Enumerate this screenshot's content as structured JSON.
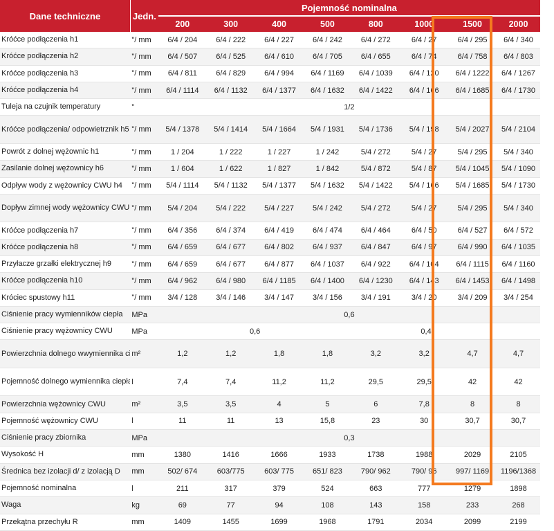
{
  "header": {
    "param_title": "Dane techniczne",
    "unit_title": "Jedn.",
    "capacity_title": "Pojemność nominalna",
    "capacities": [
      "200",
      "300",
      "400",
      "500",
      "800",
      "1000",
      "1500",
      "2000"
    ]
  },
  "highlight": {
    "column": "1500",
    "color": "#f47a1f"
  },
  "accent_color": "#c8202e",
  "rows": [
    {
      "name": "Króćce podłączenia h1",
      "unit": "\"/ mm",
      "values": [
        "6/4 / 204",
        "6/4 / 222",
        "6/4 / 227",
        "6/4 / 242",
        "6/4 / 272",
        "6/4 / 27",
        "6/4 / 295",
        "6/4 / 340"
      ]
    },
    {
      "name": "Króćce podłączenia h2",
      "unit": "\"/ mm",
      "values": [
        "6/4 / 507",
        "6/4 / 525",
        "6/4 / 610",
        "6/4 / 705",
        "6/4 / 655",
        "6/4 / 74",
        "6/4 / 758",
        "6/4 / 803"
      ]
    },
    {
      "name": "Króćce podłączenia h3",
      "unit": "\"/ mm",
      "values": [
        "6/4 / 811",
        "6/4 / 829",
        "6/4 / 994",
        "6/4 / 1169",
        "6/4 / 1039",
        "6/4 / 120",
        "6/4 / 1222",
        "6/4 / 1267"
      ]
    },
    {
      "name": "Króćce podłączenia h4",
      "unit": "\"/ mm",
      "values": [
        "6/4 / 1114",
        "6/4 / 1132",
        "6/4 / 1377",
        "6/4 / 1632",
        "6/4 / 1422",
        "6/4 / 166",
        "6/4 / 1685",
        "6/4 / 1730"
      ]
    },
    {
      "name": "Tuleja na czujnik temperatury",
      "unit": "\"",
      "span": "1/2"
    },
    {
      "name": "Króćce podłączenia/ odpowietrznik h5",
      "unit": "\"/ mm",
      "tall": true,
      "values": [
        "5/4 / 1378",
        "5/4 / 1414",
        "5/4 / 1664",
        "5/4 / 1931",
        "5/4 / 1736",
        "5/4 / 198",
        "5/4 / 2027",
        "5/4 / 2104"
      ]
    },
    {
      "name": "Powrót z dolnej wężownic h1",
      "unit": "\"/ mm",
      "values": [
        "1 / 204",
        "1 / 222",
        "1 / 227",
        "1 / 242",
        "5/4 / 272",
        "5/4 / 27",
        "5/4 / 295",
        "5/4 / 340"
      ]
    },
    {
      "name": "Zasilanie dolnej wężownicy h6",
      "unit": "\"/ mm",
      "values": [
        "1 / 604",
        "1 / 622",
        "1 / 827",
        "1 / 842",
        "5/4 / 872",
        "5/4 / 87",
        "5/4 / 1045",
        "5/4 / 1090"
      ]
    },
    {
      "name": "Odpływ wody z wężownicy CWU h4",
      "unit": "\"/ mm",
      "values": [
        "5/4 / 1114",
        "5/4 / 1132",
        "5/4 / 1377",
        "5/4 / 1632",
        "5/4 / 1422",
        "5/4 / 166",
        "5/4 / 1685",
        "5/4 / 1730"
      ]
    },
    {
      "name": "Dopływ zimnej wody wężownicy CWU h1",
      "unit": "\"/ mm",
      "tall": true,
      "values": [
        "5/4 / 204",
        "5/4 / 222",
        "5/4 / 227",
        "5/4 / 242",
        "5/4 / 272",
        "5/4 / 27",
        "5/4 / 295",
        "5/4 / 340"
      ]
    },
    {
      "name": "Króćce podłączenia h7",
      "unit": "\"/ mm",
      "values": [
        "6/4 / 356",
        "6/4 / 374",
        "6/4 / 419",
        "6/4 / 474",
        "6/4 / 464",
        "6/4 / 50",
        "6/4 / 527",
        "6/4 / 572"
      ]
    },
    {
      "name": "Króćce podłączenia h8",
      "unit": "\"/ mm",
      "values": [
        "6/4 / 659",
        "6/4 / 677",
        "6/4 / 802",
        "6/4 / 937",
        "6/4 / 847",
        "6/4 / 97",
        "6/4 / 990",
        "6/4 / 1035"
      ]
    },
    {
      "name": "Przyłacze grzałki elektrycznej h9",
      "unit": "\"/ mm",
      "values": [
        "6/4 / 659",
        "6/4 / 677",
        "6/4 / 877",
        "6/4 / 1037",
        "6/4 / 922",
        "6/4 / 104",
        "6/4 / 1115",
        "6/4 / 1160"
      ]
    },
    {
      "name": "Króćce podłączenia h10",
      "unit": "\"/ mm",
      "values": [
        "6/4 / 962",
        "6/4 / 980",
        "6/4 / 1185",
        "6/4 / 1400",
        "6/4 / 1230",
        "6/4 / 143",
        "6/4 / 1453",
        "6/4 / 1498"
      ]
    },
    {
      "name": "Króciec spustowy h11",
      "unit": "\"/ mm",
      "values": [
        "3/4 / 128",
        "3/4 / 146",
        "3/4 / 147",
        "3/4 / 156",
        "3/4 / 191",
        "3/4 / 20",
        "3/4 / 209",
        "3/4 / 254"
      ]
    },
    {
      "name": "Ciśnienie pracy wymienników ciepła",
      "unit": "MPa",
      "span": "0,6"
    },
    {
      "name": "Ciśnienie pracy wężownicy CWU",
      "unit": "MPa",
      "split": [
        "0,6",
        "0,4"
      ]
    },
    {
      "name": "Powierzchnia dolnego wwymiennika ciepła",
      "unit": "m²",
      "tall": true,
      "values": [
        "1,2",
        "1,2",
        "1,8",
        "1,8",
        "3,2",
        "3,2",
        "4,7",
        "4,7"
      ]
    },
    {
      "name": "Pojemność dolnego wymiennika ciepła",
      "unit": "l",
      "tall": true,
      "values": [
        "7,4",
        "7,4",
        "11,2",
        "11,2",
        "29,5",
        "29,5",
        "42",
        "42"
      ]
    },
    {
      "name": "Powierzchnia wężownicy CWU",
      "unit": "m²",
      "values": [
        "3,5",
        "3,5",
        "4",
        "5",
        "6",
        "7,8",
        "8",
        "8"
      ]
    },
    {
      "name": "Pojemność wężownicy CWU",
      "unit": "l",
      "values": [
        "11",
        "11",
        "13",
        "15,8",
        "23",
        "30",
        "30,7",
        "30,7"
      ]
    },
    {
      "name": "Ciśnienie pracy zbiornika",
      "unit": "MPa",
      "span": "0,3"
    },
    {
      "name": "Wysokość H",
      "unit": "mm",
      "values": [
        "1380",
        "1416",
        "1666",
        "1933",
        "1738",
        "1988",
        "2029",
        "2105"
      ]
    },
    {
      "name": "Średnica bez izolacji d/ z izolacją D",
      "unit": "mm",
      "values": [
        "502/ 674",
        "603/775",
        "603/ 775",
        "651/ 823",
        "790/ 962",
        "790/ 96",
        "997/ 1169",
        "1196/1368"
      ]
    },
    {
      "name": "Pojemność nominalna",
      "unit": "l",
      "values": [
        "211",
        "317",
        "379",
        "524",
        "663",
        "777",
        "1279",
        "1898"
      ]
    },
    {
      "name": "Waga",
      "unit": "kg",
      "values": [
        "69",
        "77",
        "94",
        "108",
        "143",
        "158",
        "233",
        "268"
      ]
    },
    {
      "name": "Przekątna przechyłu R",
      "unit": "mm",
      "values": [
        "1409",
        "1455",
        "1699",
        "1968",
        "1791",
        "2034",
        "2099",
        "2199"
      ]
    }
  ]
}
